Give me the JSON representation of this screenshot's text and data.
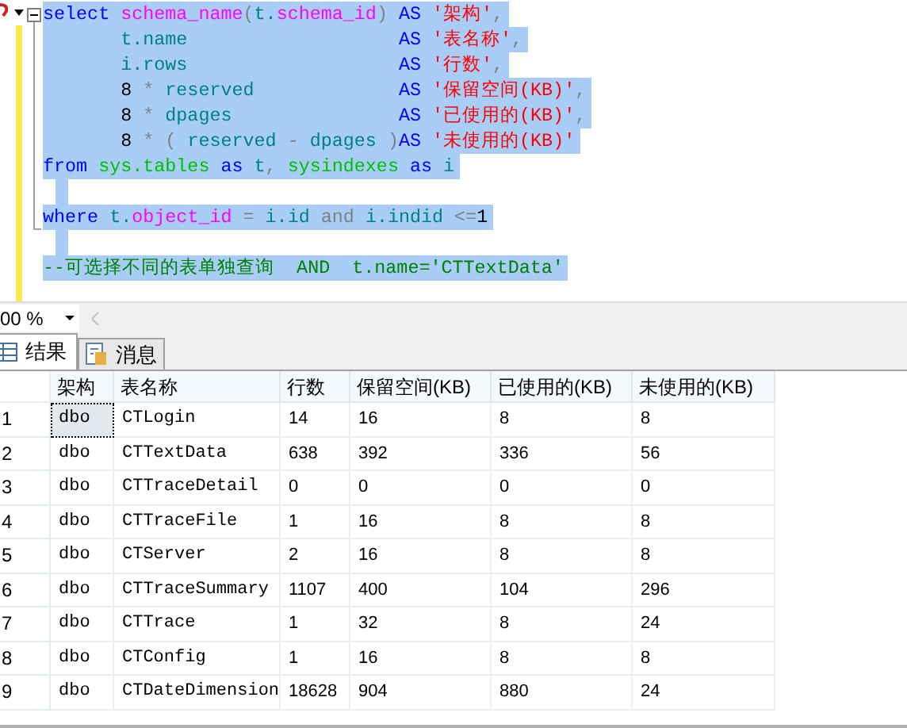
{
  "editor": {
    "lines": [
      {
        "selected": true,
        "tokens": [
          {
            "kind": "kw",
            "text": "select "
          },
          {
            "kind": "fn",
            "text": "schema_name"
          },
          {
            "kind": "op",
            "text": "("
          },
          {
            "kind": "id",
            "text": "t."
          },
          {
            "kind": "fn",
            "text": "schema_id"
          },
          {
            "kind": "op",
            "text": ") "
          },
          {
            "kind": "kw",
            "text": "AS "
          },
          {
            "kind": "str",
            "text": "'架构'"
          },
          {
            "kind": "op",
            "text": ","
          }
        ]
      },
      {
        "selected": true,
        "tokens": [
          {
            "kind": "id",
            "text": "       t.name                   "
          },
          {
            "kind": "kw",
            "text": "AS "
          },
          {
            "kind": "str",
            "text": "'表名称'"
          },
          {
            "kind": "op",
            "text": ","
          }
        ]
      },
      {
        "selected": true,
        "tokens": [
          {
            "kind": "id",
            "text": "       i.rows                   "
          },
          {
            "kind": "kw",
            "text": "AS "
          },
          {
            "kind": "str",
            "text": "'行数'"
          },
          {
            "kind": "op",
            "text": ","
          }
        ]
      },
      {
        "selected": true,
        "tokens": [
          {
            "kind": "num",
            "text": "       8 "
          },
          {
            "kind": "op",
            "text": "* "
          },
          {
            "kind": "id",
            "text": "reserved             "
          },
          {
            "kind": "kw",
            "text": "AS "
          },
          {
            "kind": "str",
            "text": "'保留空间(KB)'"
          },
          {
            "kind": "op",
            "text": ","
          }
        ]
      },
      {
        "selected": true,
        "tokens": [
          {
            "kind": "num",
            "text": "       8 "
          },
          {
            "kind": "op",
            "text": "* "
          },
          {
            "kind": "id",
            "text": "dpages               "
          },
          {
            "kind": "kw",
            "text": "AS "
          },
          {
            "kind": "str",
            "text": "'已使用的(KB)'"
          },
          {
            "kind": "op",
            "text": ","
          }
        ]
      },
      {
        "selected": true,
        "tokens": [
          {
            "kind": "num",
            "text": "       8 "
          },
          {
            "kind": "op",
            "text": "* ( "
          },
          {
            "kind": "id",
            "text": "reserved "
          },
          {
            "kind": "op",
            "text": "- "
          },
          {
            "kind": "id",
            "text": "dpages "
          },
          {
            "kind": "op",
            "text": ")"
          },
          {
            "kind": "kw",
            "text": "AS "
          },
          {
            "kind": "str",
            "text": "'未使用的(KB)'"
          }
        ]
      },
      {
        "selected": true,
        "tokens": [
          {
            "kind": "kw",
            "text": "from "
          },
          {
            "kind": "sys",
            "text": "sys.tables "
          },
          {
            "kind": "kw",
            "text": "as "
          },
          {
            "kind": "id",
            "text": "t"
          },
          {
            "kind": "op",
            "text": ", "
          },
          {
            "kind": "sys",
            "text": "sysindexes "
          },
          {
            "kind": "kw",
            "text": "as "
          },
          {
            "kind": "id",
            "text": "i"
          }
        ]
      },
      {
        "selected": true
      },
      {
        "selected": true,
        "tokens": [
          {
            "kind": "kw",
            "text": "where "
          },
          {
            "kind": "id",
            "text": "t."
          },
          {
            "kind": "fn",
            "text": "object_id "
          },
          {
            "kind": "op",
            "text": "= "
          },
          {
            "kind": "id",
            "text": "i.id "
          },
          {
            "kind": "op",
            "text": "and "
          },
          {
            "kind": "id",
            "text": "i.indid "
          },
          {
            "kind": "op",
            "text": "<="
          },
          {
            "kind": "num",
            "text": "1"
          }
        ]
      },
      {
        "selected": true
      },
      {
        "selected": true,
        "tokens": [
          {
            "kind": "cm",
            "text": "--可选择不同的表单独查询  AND  t.name='CTTextData'"
          }
        ]
      }
    ]
  },
  "zoom": {
    "value": "00 %"
  },
  "tabs": [
    {
      "label": "结果",
      "selected": true,
      "kind": "grid"
    },
    {
      "label": "消息",
      "selected": false,
      "kind": "messages"
    }
  ],
  "table": {
    "columns": [
      "架构",
      "表名称",
      "行数",
      "保留空间(KB)",
      "已使用的(KB)",
      "未使用的(KB)"
    ],
    "rows": [
      {
        "number": "1",
        "focused": true,
        "cells": [
          "dbo",
          "CTLogin",
          "14",
          "16",
          "8",
          "8"
        ]
      },
      {
        "number": "2",
        "focused": false,
        "cells": [
          "dbo",
          "CTTextData",
          "638",
          "392",
          "336",
          "56"
        ]
      },
      {
        "number": "3",
        "focused": false,
        "cells": [
          "dbo",
          "CTTraceDetail",
          "0",
          "0",
          "0",
          "0"
        ]
      },
      {
        "number": "4",
        "focused": false,
        "cells": [
          "dbo",
          "CTTraceFile",
          "1",
          "16",
          "8",
          "8"
        ]
      },
      {
        "number": "5",
        "focused": false,
        "cells": [
          "dbo",
          "CTServer",
          "2",
          "16",
          "8",
          "8"
        ]
      },
      {
        "number": "6",
        "focused": false,
        "cells": [
          "dbo",
          "CTTraceSummary",
          "1107",
          "400",
          "104",
          "296"
        ]
      },
      {
        "number": "7",
        "focused": false,
        "cells": [
          "dbo",
          "CTTrace",
          "1",
          "32",
          "8",
          "24"
        ]
      },
      {
        "number": "8",
        "focused": false,
        "cells": [
          "dbo",
          "CTConfig",
          "1",
          "16",
          "8",
          "8"
        ]
      },
      {
        "number": "9",
        "focused": false,
        "cells": [
          "dbo",
          "CTDateDimension",
          "18628",
          "904",
          "880",
          "24"
        ]
      }
    ]
  }
}
